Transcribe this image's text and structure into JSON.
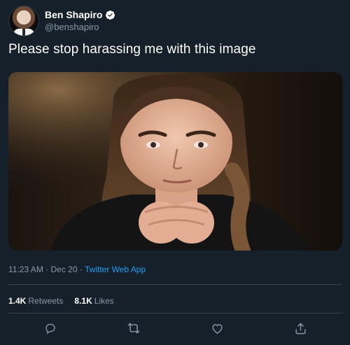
{
  "author": {
    "display_name": "Ben Shapiro",
    "handle": "@benshapiro",
    "verified": true
  },
  "tweet": {
    "text": "Please stop harassing me with this image",
    "time": "11:23 AM",
    "separator": "·",
    "date": "Dec 20",
    "source": "Twitter Web App"
  },
  "stats": {
    "retweets_count": "1.4K",
    "retweets_label": "Retweets",
    "likes_count": "8.1K",
    "likes_label": "Likes"
  },
  "actions": [
    "reply-icon",
    "retweet-icon",
    "like-icon",
    "share-icon"
  ],
  "colors": {
    "background": "#15202b",
    "secondary_text": "#8899a6",
    "accent": "#1da1f2",
    "divider": "#38444d"
  }
}
